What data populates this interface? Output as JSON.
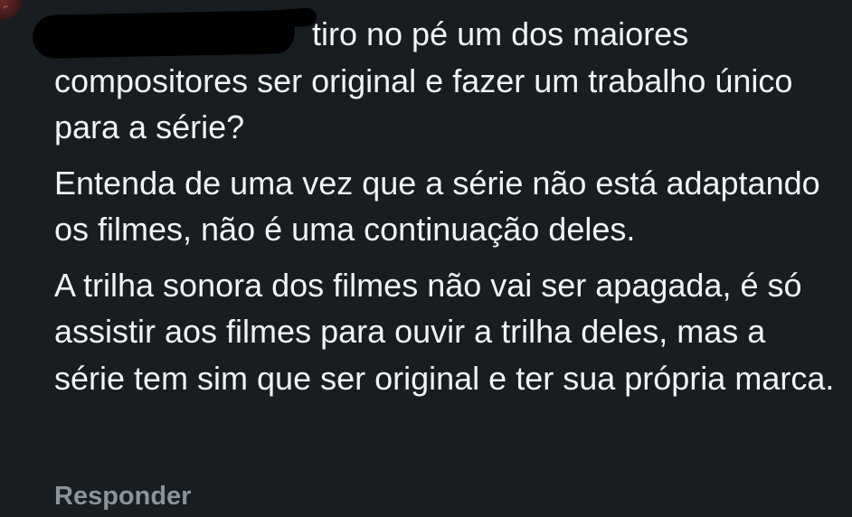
{
  "comment": {
    "paragraphs": [
      "tiro no pé um dos maiores compositores ser original e fazer um trabalho único para a série?",
      "Entenda de uma vez que a série não está adaptando os filmes, não é uma continuação deles.",
      "A trilha sonora dos filmes não vai ser apagada, é só assistir aos filmes para ouvir a trilha deles, mas a série tem sim que ser original e ter sua própria marca."
    ]
  },
  "actions": {
    "reply_label": "Responder"
  },
  "colors": {
    "background": "#171d21",
    "text": "#f2f3f5",
    "muted": "#8b939b"
  }
}
